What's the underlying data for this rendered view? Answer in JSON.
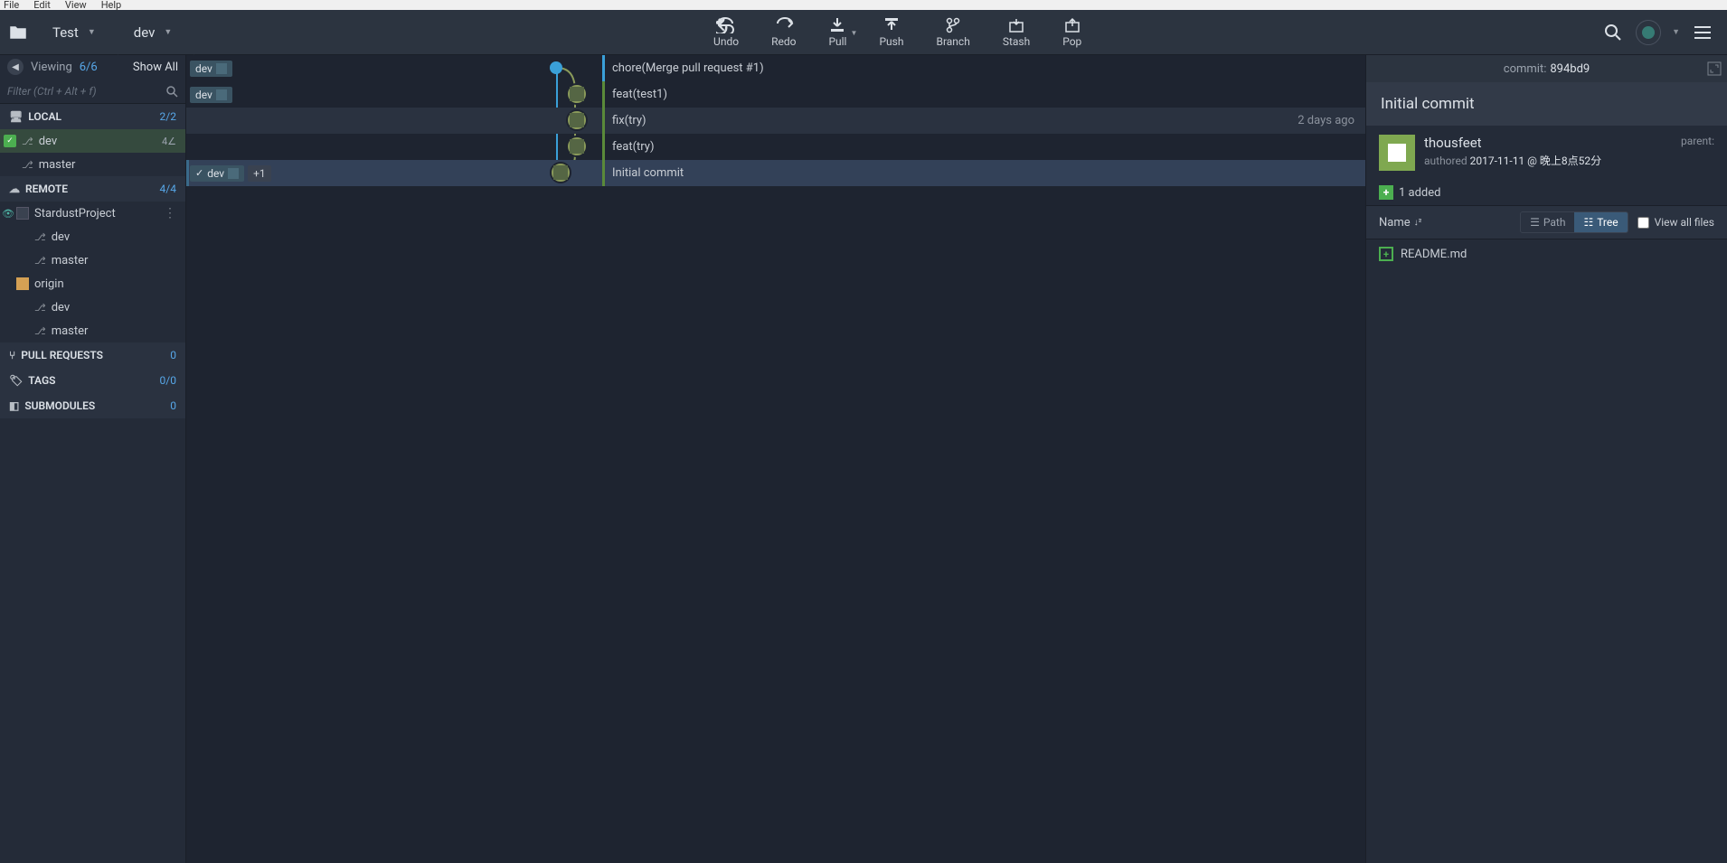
{
  "menubar": {
    "file": "File",
    "edit": "Edit",
    "view": "View",
    "help": "Help"
  },
  "breadcrumb": {
    "repo": "Test",
    "branch": "dev"
  },
  "toolbar": {
    "undo": "Undo",
    "redo": "Redo",
    "pull": "Pull",
    "push": "Push",
    "branch": "Branch",
    "stash": "Stash",
    "pop": "Pop"
  },
  "sidebar": {
    "viewing_label": "Viewing",
    "viewing_count": "6/6",
    "showall": "Show All",
    "filter_placeholder": "Filter (Ctrl + Alt + f)",
    "local": {
      "title": "LOCAL",
      "count": "2/2",
      "items": [
        {
          "name": "dev",
          "badge": "4∠",
          "active": true
        },
        {
          "name": "master"
        }
      ]
    },
    "remote": {
      "title": "REMOTE",
      "count": "4/4",
      "groups": [
        {
          "name": "StardustProject",
          "eye": true,
          "branches": [
            "dev",
            "master"
          ]
        },
        {
          "name": "origin",
          "eye": false,
          "orange": true,
          "branches": [
            "dev",
            "master"
          ]
        }
      ]
    },
    "pull_requests": {
      "title": "PULL REQUESTS",
      "count": "0"
    },
    "tags": {
      "title": "TAGS",
      "count": "0/0"
    },
    "submodules": {
      "title": "SUBMODULES",
      "count": "0"
    }
  },
  "commits": [
    {
      "tags": [
        {
          "label": "dev",
          "check": false
        }
      ],
      "msg": "chore(Merge pull request #1)",
      "blue": true
    },
    {
      "tags": [
        {
          "label": "dev",
          "check": false
        }
      ],
      "msg": "feat(test1)"
    },
    {
      "msg": "fix(try)",
      "time": "2 days ago",
      "hover": true
    },
    {
      "msg": "feat(try)"
    },
    {
      "tags": [
        {
          "label": "dev",
          "check": true
        }
      ],
      "plus": "+1",
      "msg": "Initial commit",
      "selected": true
    }
  ],
  "detail": {
    "commit_label": "commit:",
    "commit_hash": "894bd9",
    "title": "Initial commit",
    "author": "thousfeet",
    "authored_label": "authored",
    "date": "2017-11-11 @ 晚上8点52分",
    "parent_label": "parent:",
    "changes": "1 added",
    "name_col": "Name",
    "path_btn": "Path",
    "tree_btn": "Tree",
    "viewall": "View all files",
    "files": [
      "README.md"
    ]
  }
}
